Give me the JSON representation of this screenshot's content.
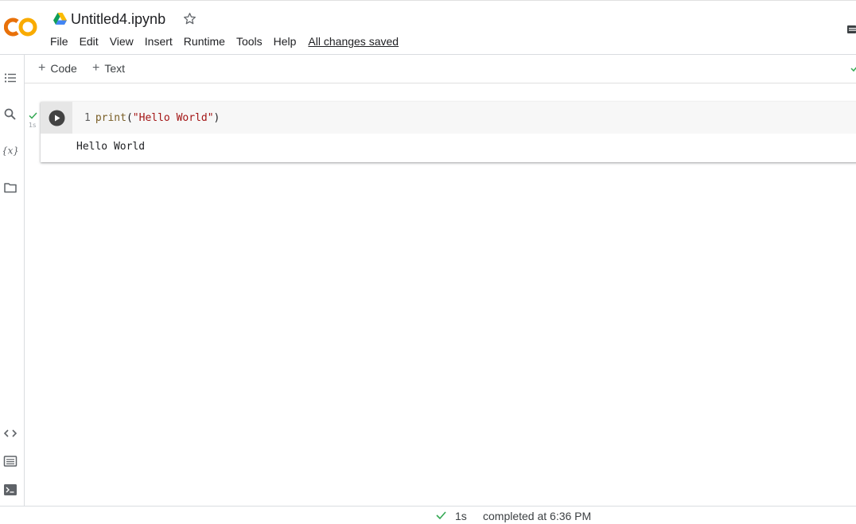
{
  "header": {
    "logo_text": "CO",
    "title": "Untitled4.ipynb",
    "menu": [
      "File",
      "Edit",
      "View",
      "Insert",
      "Runtime",
      "Tools",
      "Help"
    ],
    "save_status": "All changes saved"
  },
  "toolbar": {
    "add_code_label": "Code",
    "add_text_label": "Text"
  },
  "sidebar": {
    "icons": [
      "table-of-contents-icon",
      "search-icon",
      "variables-icon",
      "files-icon",
      "code-snippets-icon",
      "command-palette-icon",
      "terminal-icon"
    ]
  },
  "cell": {
    "line_number": "1",
    "code_fn": "print",
    "code_open": "(",
    "code_string": "\"Hello World\"",
    "code_close": ")",
    "exec_time": "1s",
    "output": "Hello World"
  },
  "statusbar": {
    "duration": "1s",
    "message": "completed at 6:36 PM"
  },
  "colors": {
    "logo_orange": "#f9ab00",
    "logo_dark_orange": "#e8710a",
    "success_green": "#34a853",
    "run_button": "#424242"
  }
}
